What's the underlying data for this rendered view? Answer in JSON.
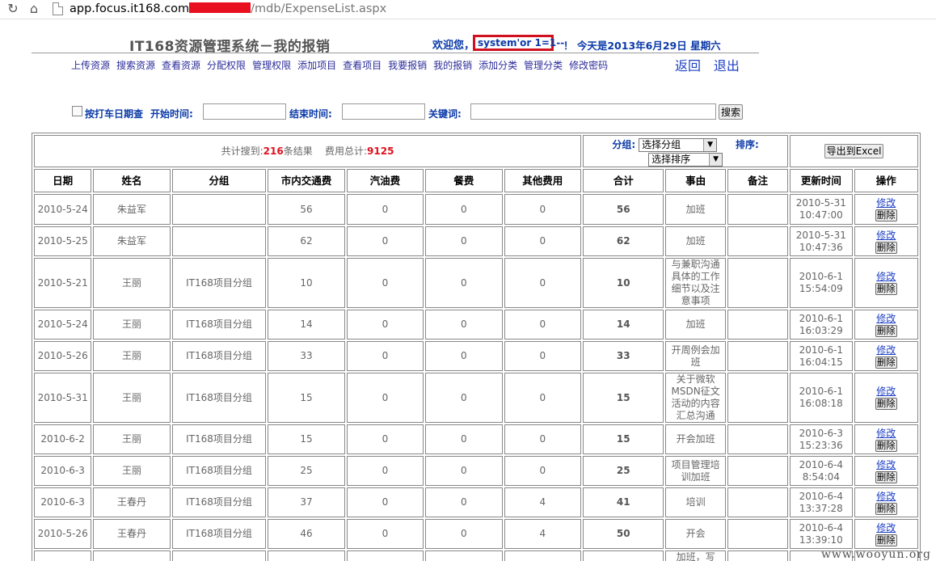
{
  "browser": {
    "url_host": "app.focus.it168.com",
    "url_path": "/mdb/ExpenseList.aspx"
  },
  "header": {
    "title": "IT168资源管理系统－我的报销",
    "welcome": "欢迎您，",
    "username": "system'or 1=1--",
    "today": "！ 今天是2013年6月29日 星期六"
  },
  "nav": {
    "items": [
      "上传资源",
      "搜索资源",
      "查看资源",
      "分配权限",
      "管理权限",
      "添加项目",
      "查看项目",
      "我要报销",
      "我的报销",
      "添加分类",
      "管理分类",
      "修改密码"
    ],
    "back": "返回",
    "logout": "退出"
  },
  "filter": {
    "by_date_label": "按打车日期查",
    "start_label": "开始时间:",
    "end_label": "结束时间:",
    "keyword_label": "关键词:",
    "search_button": "搜索"
  },
  "summary": {
    "prefix": "共计搜到:",
    "count": "216",
    "suffix": "条结果",
    "cost_label": "费用总计:",
    "cost_total": "9125",
    "group_label": "分组:",
    "group_select": "选择分组",
    "sort_label": "排序:",
    "sort_select": "选择排序",
    "export_button": "导出到Excel"
  },
  "table": {
    "headers": [
      "日期",
      "姓名",
      "分组",
      "市内交通费",
      "汽油费",
      "餐费",
      "其他费用",
      "合计",
      "事由",
      "备注",
      "更新时间",
      "操作"
    ],
    "edit_label": "修改",
    "delete_label": "删除",
    "rows": [
      {
        "date": "2010-5-24",
        "name": "朱益军",
        "group": "",
        "transport": "56",
        "fuel": "0",
        "meal": "0",
        "other": "0",
        "total": "56",
        "reason": "加班",
        "note": "",
        "updated": "2010-5-31\n10:47:00"
      },
      {
        "date": "2010-5-25",
        "name": "朱益军",
        "group": "",
        "transport": "62",
        "fuel": "0",
        "meal": "0",
        "other": "0",
        "total": "62",
        "reason": "加班",
        "note": "",
        "updated": "2010-5-31\n10:47:36"
      },
      {
        "date": "2010-5-21",
        "name": "王丽",
        "group": "IT168项目分组",
        "transport": "10",
        "fuel": "0",
        "meal": "0",
        "other": "0",
        "total": "10",
        "reason": "与兼职沟通具体的工作细节以及注意事项",
        "note": "",
        "updated": "2010-6-1\n15:54:09"
      },
      {
        "date": "2010-5-24",
        "name": "王丽",
        "group": "IT168项目分组",
        "transport": "14",
        "fuel": "0",
        "meal": "0",
        "other": "0",
        "total": "14",
        "reason": "加班",
        "note": "",
        "updated": "2010-6-1\n16:03:29"
      },
      {
        "date": "2010-5-26",
        "name": "王丽",
        "group": "IT168项目分组",
        "transport": "33",
        "fuel": "0",
        "meal": "0",
        "other": "0",
        "total": "33",
        "reason": "开周例会加班",
        "note": "",
        "updated": "2010-6-1\n16:04:15"
      },
      {
        "date": "2010-5-31",
        "name": "王丽",
        "group": "IT168项目分组",
        "transport": "15",
        "fuel": "0",
        "meal": "0",
        "other": "0",
        "total": "15",
        "reason": "关于微软MSDN征文活动的内容汇总沟通",
        "note": "",
        "updated": "2010-6-1\n16:08:18"
      },
      {
        "date": "2010-6-2",
        "name": "王丽",
        "group": "IT168项目分组",
        "transport": "15",
        "fuel": "0",
        "meal": "0",
        "other": "0",
        "total": "15",
        "reason": "开会加班",
        "note": "",
        "updated": "2010-6-3\n15:23:36"
      },
      {
        "date": "2010-6-3",
        "name": "王丽",
        "group": "IT168项目分组",
        "transport": "25",
        "fuel": "0",
        "meal": "0",
        "other": "0",
        "total": "25",
        "reason": "项目管理培训加班",
        "note": "",
        "updated": "2010-6-4\n8:54:04"
      },
      {
        "date": "2010-6-3",
        "name": "王春丹",
        "group": "IT168项目分组",
        "transport": "37",
        "fuel": "0",
        "meal": "0",
        "other": "4",
        "total": "41",
        "reason": "培训",
        "note": "",
        "updated": "2010-6-4\n13:37:28"
      },
      {
        "date": "2010-5-26",
        "name": "王春丹",
        "group": "IT168项目分组",
        "transport": "46",
        "fuel": "0",
        "meal": "0",
        "other": "4",
        "total": "50",
        "reason": "开会",
        "note": "",
        "updated": "2010-6-4\n13:39:10"
      },
      {
        "date": "",
        "name": "",
        "group": "",
        "transport": "",
        "fuel": "",
        "meal": "",
        "other": "",
        "total": "",
        "reason": "加班，写",
        "note": "",
        "updated": ""
      }
    ]
  },
  "watermark": "www.wooyun.org"
}
